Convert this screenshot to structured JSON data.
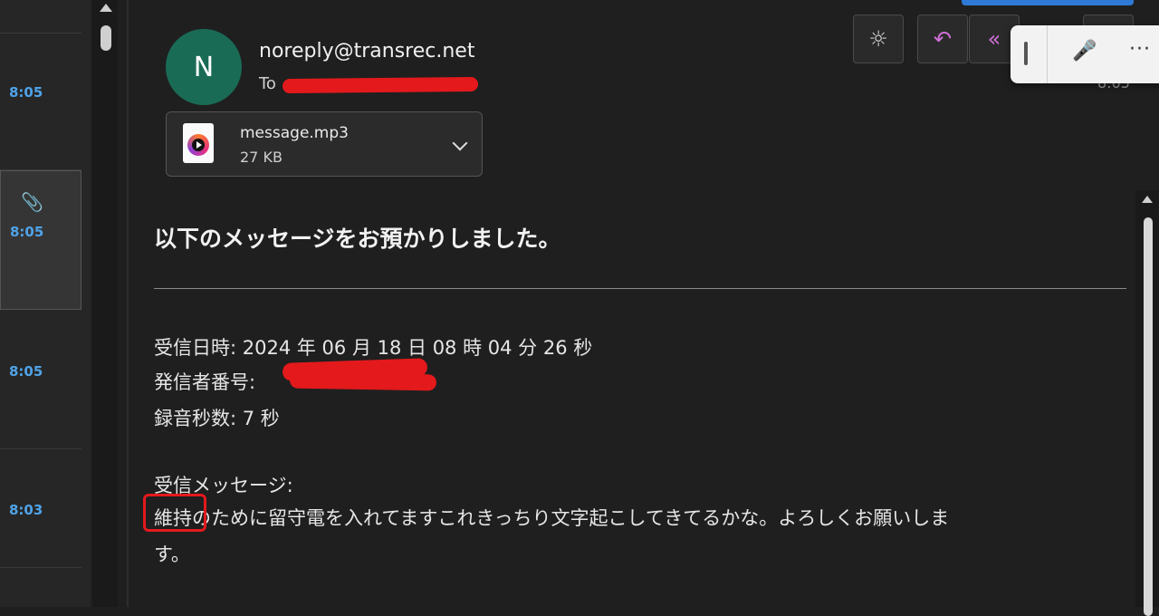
{
  "message_list": {
    "items": [
      {
        "time": "8:05",
        "has_attachment": false,
        "selected": false
      },
      {
        "time": "8:05",
        "has_attachment": true,
        "selected": true
      },
      {
        "time": "8:05",
        "has_attachment": false,
        "selected": false
      },
      {
        "time": "8:03",
        "has_attachment": false,
        "selected": false
      }
    ]
  },
  "header": {
    "avatar_initial": "N",
    "sender": "noreply@transrec.net",
    "to_label": "To",
    "time": "8:05"
  },
  "attachment": {
    "file_name": "message.mp3",
    "file_size": "27 KB"
  },
  "toolbar": {
    "icons": [
      "sun-icon",
      "reply-icon",
      "reply-all-icon"
    ],
    "reply_color": "#d070d8"
  },
  "voice_bar": {
    "icons": [
      "grip-icon",
      "microphone-icon",
      "more-icon"
    ],
    "more_glyph": "···"
  },
  "body": {
    "heading": "以下のメッセージをお預かりしました。",
    "received_datetime": "受信日時: 2024 年 06 月 18 日 08 時 04 分 26 秒",
    "caller_number_label": "発信者番号:",
    "recording_seconds": "録音秒数: 7 秒",
    "received_message_label": "受信メッセージ:",
    "message_line1": "維持のために留守電を入れてますこれきっちり文字起こしてきてるかな。よろしくお願いしま",
    "message_line2": "す。"
  },
  "colors": {
    "background": "#1f1f1f",
    "time_blue": "#4fa3e8",
    "avatar_green": "#1a6b56",
    "redaction_red": "#e3191c"
  }
}
